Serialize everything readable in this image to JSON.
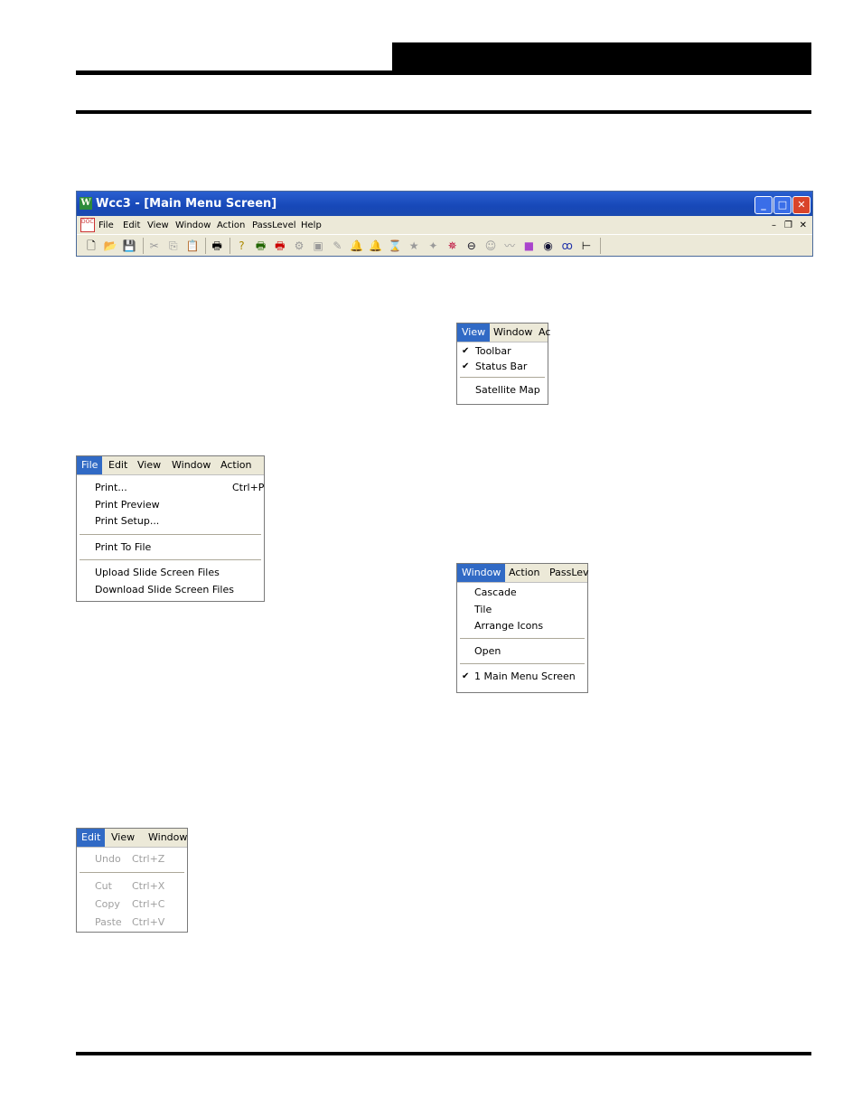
{
  "window": {
    "title": "Wcc3 - [Main Menu Screen]",
    "app_icon": "W",
    "controls": [
      "minimize",
      "maximize",
      "close"
    ],
    "doc_controls": [
      "minimize",
      "restore",
      "close"
    ],
    "menu": [
      "File",
      "Edit",
      "View",
      "Window",
      "Action",
      "PassLevel",
      "Help"
    ],
    "toolbar": [
      "new-icon",
      "open-icon",
      "save-icon",
      "|",
      "cut-icon",
      "copy-icon",
      "paste-icon",
      "|",
      "print-icon",
      "|",
      "help-icon",
      "print-green-icon",
      "print-red-icon",
      "tool-a-icon",
      "tool-b-icon",
      "tool-c-icon",
      "bell-icon",
      "bell2-icon",
      "hourglass-icon",
      "star-icon",
      "stars-icon",
      "network-icon",
      "key-icon",
      "people-icon",
      "chart-icon",
      "color-icon",
      "eye-icon",
      "tam-icon",
      "tree-icon"
    ]
  },
  "view_menu": {
    "bar": [
      "View",
      "Window",
      "Ac"
    ],
    "items": [
      {
        "label": "Toolbar",
        "checked": true
      },
      {
        "label": "Status Bar",
        "checked": true
      },
      {
        "label": "Satellite Map",
        "checked": false
      }
    ]
  },
  "file_menu": {
    "bar": [
      "File",
      "Edit",
      "View",
      "Window",
      "Action"
    ],
    "items": [
      {
        "label": "Print...",
        "shortcut": "Ctrl+P"
      },
      {
        "label": "Print Preview"
      },
      {
        "label": "Print Setup..."
      },
      {
        "label": "Print To File"
      },
      {
        "label": "Upload Slide Screen Files"
      },
      {
        "label": "Download Slide Screen Files"
      }
    ]
  },
  "window_menu": {
    "bar": [
      "Window",
      "Action",
      "PassLev"
    ],
    "items": [
      {
        "label": "Cascade"
      },
      {
        "label": "Tile"
      },
      {
        "label": "Arrange Icons"
      },
      {
        "label": "Open"
      },
      {
        "label": "1 Main Menu Screen",
        "checked": true
      }
    ]
  },
  "edit_menu": {
    "bar": [
      "Edit",
      "View",
      "Window"
    ],
    "items": [
      {
        "label": "Undo",
        "shortcut": "Ctrl+Z"
      },
      {
        "label": "Cut",
        "shortcut": "Ctrl+X"
      },
      {
        "label": "Copy",
        "shortcut": "Ctrl+C"
      },
      {
        "label": "Paste",
        "shortcut": "Ctrl+V"
      }
    ]
  }
}
